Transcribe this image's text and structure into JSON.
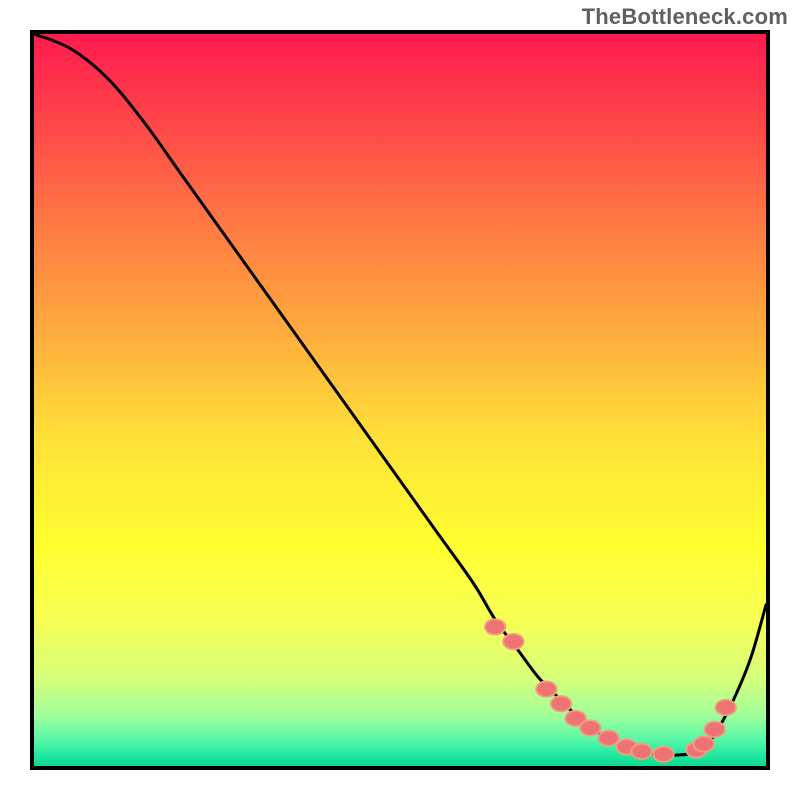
{
  "watermark": "TheBottleneck.com",
  "colors": {
    "frame": "#000000",
    "curve": "#000000",
    "marker_fill": "#ef7374",
    "marker_stroke": "#efa07e",
    "gradient_stops": [
      {
        "offset": 0.0,
        "color": "#ff1a4f"
      },
      {
        "offset": 0.1,
        "color": "#ff3e4a"
      },
      {
        "offset": 0.25,
        "color": "#ff7644"
      },
      {
        "offset": 0.4,
        "color": "#ffa93e"
      },
      {
        "offset": 0.55,
        "color": "#ffe038"
      },
      {
        "offset": 0.7,
        "color": "#ffff30"
      },
      {
        "offset": 0.8,
        "color": "#f7ff54"
      },
      {
        "offset": 0.88,
        "color": "#d6ff7a"
      },
      {
        "offset": 0.93,
        "color": "#a2ff99"
      },
      {
        "offset": 0.965,
        "color": "#56f7a8"
      },
      {
        "offset": 0.985,
        "color": "#20e8a0"
      },
      {
        "offset": 1.0,
        "color": "#0fd890"
      }
    ]
  },
  "chart_data": {
    "type": "line",
    "title": "",
    "xlabel": "",
    "ylabel": "",
    "xlim": [
      0,
      100
    ],
    "ylim": [
      0,
      100
    ],
    "grid": false,
    "series": [
      {
        "name": "curve",
        "x": [
          0,
          5,
          10,
          15,
          20,
          25,
          30,
          35,
          40,
          45,
          50,
          55,
          60,
          63,
          66,
          69,
          72,
          75,
          78,
          81,
          84,
          86,
          88,
          90,
          92,
          94,
          96,
          98,
          100
        ],
        "y": [
          100,
          98,
          94,
          88,
          81,
          74,
          67,
          60,
          53,
          46,
          39,
          32,
          25,
          20,
          16,
          12,
          9,
          6,
          4,
          2.5,
          1.8,
          1.5,
          1.5,
          1.8,
          3,
          6,
          10,
          15,
          22
        ]
      }
    ],
    "markers": {
      "name": "dots",
      "x": [
        63,
        65.5,
        70,
        72,
        74,
        76,
        78.5,
        81,
        83,
        86,
        90.5,
        91.5,
        93,
        94.5
      ],
      "y": [
        19,
        17,
        10.5,
        8.5,
        6.5,
        5.2,
        3.8,
        2.6,
        2.0,
        1.6,
        2.2,
        3.0,
        5.0,
        8.0
      ]
    }
  }
}
